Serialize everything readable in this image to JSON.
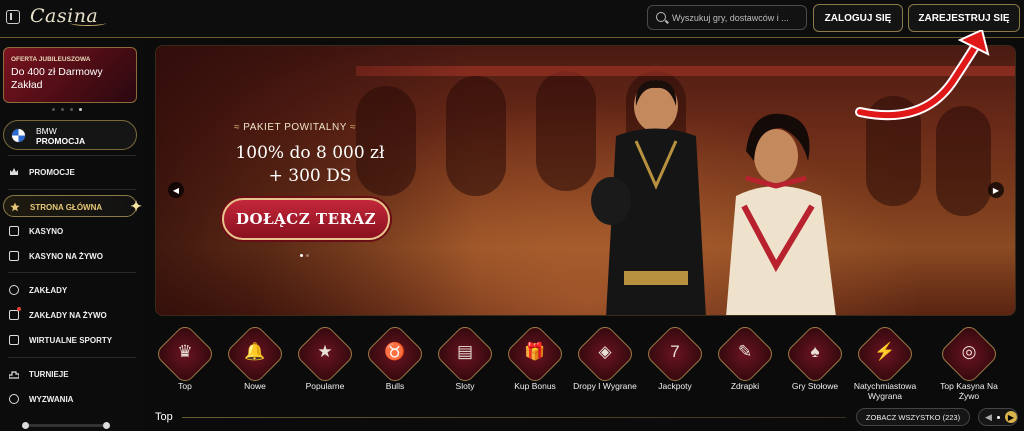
{
  "header": {
    "logo_text": "Casina",
    "search_placeholder": "Wyszukuj gry, dostawców i ...",
    "login_label": "ZALOGUJ SIĘ",
    "register_label": "ZAREJESTRUJ SIĘ"
  },
  "sidebar": {
    "promo": {
      "small": "OFERTA JUBILEUSZOWA",
      "big": "Do 400 zł Darmowy Zakład"
    },
    "bmw": {
      "line1": "BMW",
      "line2": "PROMOCJA"
    },
    "items": [
      {
        "label": "PROMOCJE",
        "icon": "crown-icon"
      },
      {
        "label": "STRONA GŁÓWNA",
        "icon": "star-icon",
        "active": true
      },
      {
        "label": "KASYNO",
        "icon": "cards-icon"
      },
      {
        "label": "KASYNO NA ŻYWO",
        "icon": "live-cards-icon"
      },
      {
        "label": "ZAKŁADY",
        "icon": "ball-icon"
      },
      {
        "label": "ZAKŁADY NA ŻYWO",
        "icon": "live-icon"
      },
      {
        "label": "WIRTUALNE SPORTY",
        "icon": "monitor-icon"
      },
      {
        "label": "TURNIEJE",
        "icon": "podium-icon"
      },
      {
        "label": "WYZWANIA",
        "icon": "target-icon"
      }
    ]
  },
  "banner": {
    "tagline": "PAKIET POWITALNY",
    "headline_line1": "100% do 8 000 zł",
    "headline_line2": "+ 300 DS",
    "cta_label": "DOŁĄCZ TERAZ"
  },
  "categories": [
    {
      "label": "Top",
      "glyph": "♛",
      "icon": "crown-icon"
    },
    {
      "label": "Nowe",
      "glyph": "🔔",
      "icon": "bell-icon"
    },
    {
      "label": "Popularne",
      "glyph": "★",
      "icon": "star-icon"
    },
    {
      "label": "Bulls",
      "glyph": "♉",
      "icon": "bull-icon"
    },
    {
      "label": "Sloty",
      "glyph": "▤",
      "icon": "slot-machine-icon"
    },
    {
      "label": "Kup Bonus",
      "glyph": "🎁",
      "icon": "gift-icon"
    },
    {
      "label": "Dropy I Wygrane",
      "glyph": "◈",
      "icon": "drops-wins-icon"
    },
    {
      "label": "Jackpoty",
      "glyph": "7",
      "icon": "jackpot-seven-icon"
    },
    {
      "label": "Zdrapki",
      "glyph": "✎",
      "icon": "scratch-icon"
    },
    {
      "label": "Gry Stołowe",
      "glyph": "♠",
      "icon": "table-cards-icon"
    },
    {
      "label": "Natychmiastowa Wygrana",
      "glyph": "⚡",
      "icon": "lightning-icon"
    },
    {
      "label": "Top Kasyna Na Żywo",
      "glyph": "◎",
      "icon": "roulette-icon"
    }
  ],
  "section": {
    "title": "Top",
    "see_all_label": "ZOBACZ WSZYSTKO (223)"
  },
  "colors": {
    "accent_gold": "#c9a85a",
    "brand_red": "#a81c2e",
    "background": "#0b0b0c"
  }
}
